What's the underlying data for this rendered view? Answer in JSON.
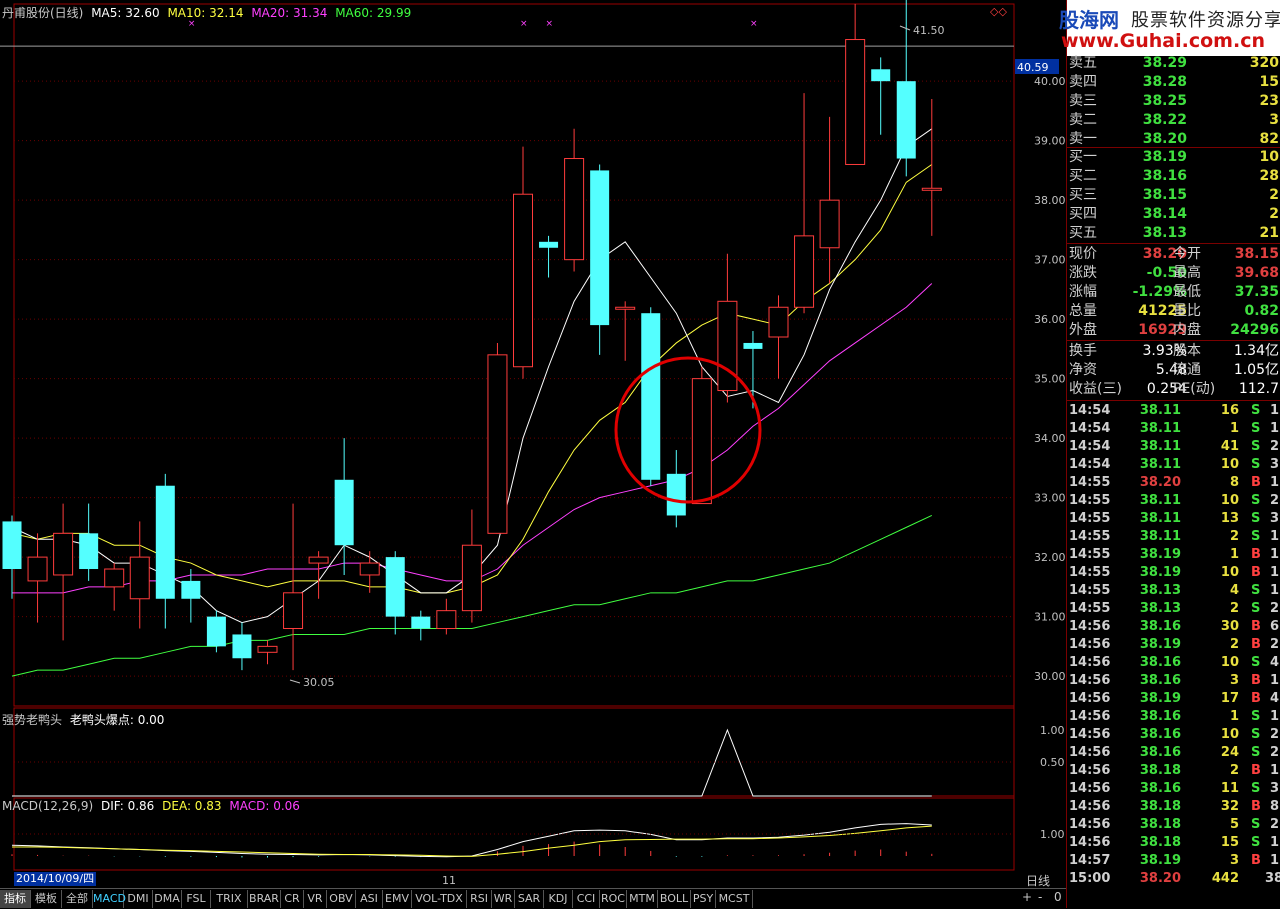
{
  "header": {
    "title": "丹甫股份(日线)",
    "ma5": "MA5: 32.60",
    "ma10": "MA10: 32.14",
    "ma20": "MA20: 31.34",
    "ma60": "MA60: 29.99"
  },
  "chart_data": {
    "type": "candlestick",
    "ylim": [
      29.8,
      41.6
    ],
    "y_ticks": [
      "40.00",
      "39.00",
      "38.00",
      "37.00",
      "36.00",
      "35.00",
      "34.00",
      "33.00",
      "32.00",
      "31.00",
      "30.00"
    ],
    "high_label": "41.50",
    "low_label": "30.05",
    "current_line_label": "40.59",
    "candles": [
      {
        "o": 32.6,
        "c": 31.8,
        "h": 32.7,
        "l": 31.3
      },
      {
        "o": 31.6,
        "c": 32.0,
        "h": 32.4,
        "l": 30.9
      },
      {
        "o": 31.7,
        "c": 32.4,
        "h": 32.9,
        "l": 30.6
      },
      {
        "o": 32.4,
        "c": 31.8,
        "h": 32.9,
        "l": 31.6
      },
      {
        "o": 31.5,
        "c": 31.8,
        "h": 31.9,
        "l": 31.1
      },
      {
        "o": 31.3,
        "c": 32.0,
        "h": 32.6,
        "l": 30.8
      },
      {
        "o": 33.2,
        "c": 31.3,
        "h": 33.4,
        "l": 30.8
      },
      {
        "o": 31.6,
        "c": 31.3,
        "h": 31.8,
        "l": 30.9
      },
      {
        "o": 31.0,
        "c": 30.5,
        "h": 31.1,
        "l": 30.4
      },
      {
        "o": 30.7,
        "c": 30.3,
        "h": 30.9,
        "l": 30.1
      },
      {
        "o": 30.4,
        "c": 30.5,
        "h": 30.6,
        "l": 30.2
      },
      {
        "o": 30.8,
        "c": 31.4,
        "h": 32.9,
        "l": 30.1
      },
      {
        "o": 31.9,
        "c": 32.0,
        "h": 32.1,
        "l": 31.3
      },
      {
        "o": 33.3,
        "c": 32.2,
        "h": 34.0,
        "l": 31.7
      },
      {
        "o": 31.7,
        "c": 31.9,
        "h": 32.1,
        "l": 31.4
      },
      {
        "o": 32.0,
        "c": 31.0,
        "h": 32.1,
        "l": 30.7
      },
      {
        "o": 31.0,
        "c": 30.8,
        "h": 31.1,
        "l": 30.6
      },
      {
        "o": 30.8,
        "c": 31.1,
        "h": 31.3,
        "l": 30.7
      },
      {
        "o": 31.1,
        "c": 32.2,
        "h": 32.8,
        "l": 30.9
      },
      {
        "o": 32.4,
        "c": 35.4,
        "h": 35.6,
        "l": 32.4
      },
      {
        "o": 35.2,
        "c": 38.1,
        "h": 38.9,
        "l": 35.0
      },
      {
        "o": 37.3,
        "c": 37.2,
        "h": 37.4,
        "l": 36.7
      },
      {
        "o": 37.0,
        "c": 38.7,
        "h": 39.2,
        "l": 36.8
      },
      {
        "o": 38.5,
        "c": 35.9,
        "h": 38.6,
        "l": 35.4
      },
      {
        "o": 36.2,
        "c": 36.2,
        "h": 36.3,
        "l": 35.3
      },
      {
        "o": 36.1,
        "c": 33.3,
        "h": 36.2,
        "l": 33.2
      },
      {
        "o": 33.4,
        "c": 32.7,
        "h": 33.8,
        "l": 32.5
      },
      {
        "o": 32.9,
        "c": 35.0,
        "h": 35.2,
        "l": 32.9
      },
      {
        "o": 34.8,
        "c": 36.3,
        "h": 37.1,
        "l": 34.6
      },
      {
        "o": 35.6,
        "c": 35.5,
        "h": 35.8,
        "l": 34.5
      },
      {
        "o": 35.7,
        "c": 36.2,
        "h": 36.4,
        "l": 35.0
      },
      {
        "o": 36.2,
        "c": 37.4,
        "h": 39.8,
        "l": 36.1
      },
      {
        "o": 37.2,
        "c": 38.0,
        "h": 39.4,
        "l": 36.6
      },
      {
        "o": 38.6,
        "c": 40.7,
        "h": 41.3,
        "l": 38.6
      },
      {
        "o": 40.2,
        "c": 40.0,
        "h": 40.4,
        "l": 39.1
      },
      {
        "o": 40.0,
        "c": 38.7,
        "h": 41.5,
        "l": 38.4
      },
      {
        "o": 38.2,
        "c": 38.2,
        "h": 39.7,
        "l": 37.4
      }
    ],
    "ma5": [
      32.5,
      32.3,
      32.3,
      32.2,
      31.9,
      31.9,
      31.7,
      31.5,
      31.1,
      30.9,
      31.0,
      31.3,
      31.6,
      32.2,
      32.0,
      31.7,
      31.4,
      31.4,
      31.7,
      32.2,
      34.0,
      35.2,
      36.3,
      37.0,
      37.3,
      36.7,
      36.1,
      35.2,
      34.7,
      34.8,
      34.6,
      35.4,
      36.5,
      37.3,
      38.0,
      38.9,
      39.2
    ],
    "ma10": [
      32.4,
      32.3,
      32.4,
      32.4,
      32.2,
      32.2,
      32.0,
      31.9,
      31.7,
      31.6,
      31.5,
      31.6,
      31.6,
      31.6,
      31.5,
      31.5,
      31.4,
      31.4,
      31.5,
      31.7,
      32.3,
      33.1,
      33.8,
      34.3,
      34.6,
      35.2,
      35.6,
      35.9,
      36.1,
      36.0,
      35.9,
      36.3,
      36.6,
      37.0,
      37.5,
      38.3,
      38.6
    ],
    "ma20": [
      31.4,
      31.4,
      31.4,
      31.5,
      31.5,
      31.6,
      31.6,
      31.7,
      31.7,
      31.7,
      31.8,
      31.8,
      31.8,
      31.9,
      31.9,
      31.8,
      31.7,
      31.6,
      31.6,
      31.8,
      32.2,
      32.5,
      32.8,
      33.0,
      33.1,
      33.2,
      33.3,
      33.5,
      33.8,
      34.2,
      34.5,
      34.9,
      35.3,
      35.6,
      35.9,
      36.2,
      36.6
    ],
    "ma60": [
      30.0,
      30.1,
      30.1,
      30.2,
      30.3,
      30.3,
      30.4,
      30.5,
      30.5,
      30.6,
      30.6,
      30.7,
      30.7,
      30.7,
      30.8,
      30.8,
      30.8,
      30.8,
      30.8,
      30.9,
      31.0,
      31.1,
      31.2,
      31.2,
      31.3,
      31.4,
      31.4,
      31.5,
      31.6,
      31.6,
      31.7,
      31.8,
      31.9,
      32.1,
      32.3,
      32.5,
      32.7
    ],
    "signals": [
      7,
      20,
      21,
      29
    ],
    "ind1": {
      "label": "强势老鸭头",
      "sub": "老鸭头爆点: 0.00",
      "ticks": [
        "1.00",
        "0.50"
      ],
      "values": [
        0,
        0,
        0,
        0,
        0,
        0,
        0,
        0,
        0,
        0,
        0,
        0,
        0,
        0,
        0,
        0,
        0,
        0,
        0,
        0,
        0,
        0,
        0,
        0,
        0,
        0,
        0,
        0,
        1,
        0,
        0,
        0,
        0,
        0,
        0,
        0,
        0
      ]
    },
    "macd": {
      "label": "MACD(12,26,9)",
      "dif": "DIF: 0.86",
      "dea": "DEA: 0.83",
      "macd": "MACD: 0.06",
      "ticks": [
        "1.00"
      ],
      "dif_v": [
        0.3,
        0.28,
        0.25,
        0.23,
        0.2,
        0.18,
        0.15,
        0.13,
        0.1,
        0.07,
        0.05,
        0.04,
        0.03,
        0.04,
        0.03,
        0.01,
        -0.01,
        -0.02,
        0.0,
        0.18,
        0.4,
        0.55,
        0.7,
        0.72,
        0.7,
        0.6,
        0.45,
        0.45,
        0.5,
        0.5,
        0.52,
        0.58,
        0.66,
        0.78,
        0.88,
        0.9,
        0.86
      ],
      "dea_v": [
        0.25,
        0.25,
        0.24,
        0.22,
        0.2,
        0.18,
        0.16,
        0.15,
        0.13,
        0.11,
        0.09,
        0.07,
        0.05,
        0.04,
        0.04,
        0.03,
        0.02,
        0.0,
        -0.01,
        0.05,
        0.12,
        0.22,
        0.3,
        0.4,
        0.45,
        0.46,
        0.47,
        0.47,
        0.48,
        0.48,
        0.5,
        0.53,
        0.57,
        0.63,
        0.7,
        0.78,
        0.83
      ],
      "hist": [
        0.05,
        0.03,
        0.01,
        0.01,
        -0.01,
        -0.01,
        -0.02,
        -0.02,
        -0.03,
        -0.04,
        -0.04,
        -0.03,
        -0.02,
        0,
        -0.01,
        -0.02,
        -0.03,
        -0.02,
        0.01,
        0.13,
        0.28,
        0.33,
        0.4,
        0.32,
        0.25,
        0.14,
        -0.02,
        -0.02,
        0.02,
        0.02,
        0.02,
        0.05,
        0.09,
        0.15,
        0.18,
        0.12,
        0.06
      ]
    }
  },
  "date_label": "2014/10/09/四",
  "axis_mark": "11",
  "period_label": "日线",
  "tabs": [
    "指标",
    "模板",
    "全部",
    "MACD",
    "DMI",
    "DMA",
    "FSL",
    "TRIX",
    "BRAR",
    "CR",
    "VR",
    "OBV",
    "ASI",
    "EMV",
    "VOL-TDX",
    "RSI",
    "WR",
    "SAR",
    "KDJ",
    "CCI",
    "ROC",
    "MTM",
    "BOLL",
    "PSY",
    "MCST"
  ],
  "nav": {
    "plus": "+",
    "minus": "-",
    "zero": "0"
  },
  "logo": {
    "l1": "股海网",
    "l1b": "股票软件资源分享",
    "l2": "www.Guhai.com.cn"
  },
  "order_book": {
    "sell": [
      {
        "label": "卖五",
        "price": "38.29",
        "vol": "320"
      },
      {
        "label": "卖四",
        "price": "38.28",
        "vol": "15"
      },
      {
        "label": "卖三",
        "price": "38.25",
        "vol": "23"
      },
      {
        "label": "卖二",
        "price": "38.22",
        "vol": "3"
      },
      {
        "label": "卖一",
        "price": "38.20",
        "vol": "82"
      }
    ],
    "buy": [
      {
        "label": "买一",
        "price": "38.19",
        "vol": "10"
      },
      {
        "label": "买二",
        "price": "38.16",
        "vol": "28"
      },
      {
        "label": "买三",
        "price": "38.15",
        "vol": "2"
      },
      {
        "label": "买四",
        "price": "38.14",
        "vol": "2"
      },
      {
        "label": "买五",
        "price": "38.13",
        "vol": "21"
      }
    ]
  },
  "quote": [
    {
      "l1": "现价",
      "v1": "38.20",
      "c1": "#e04040",
      "l2": "今开",
      "v2": "38.15",
      "c2": "#e04040"
    },
    {
      "l1": "涨跌",
      "v1": "-0.50",
      "c1": "#40e040",
      "l2": "最高",
      "v2": "39.68",
      "c2": "#e04040"
    },
    {
      "l1": "涨幅",
      "v1": "-1.29%",
      "c1": "#40e040",
      "l2": "最低",
      "v2": "37.35",
      "c2": "#40e040"
    },
    {
      "l1": "总量",
      "v1": "41225",
      "c1": "#e8e040",
      "l2": "量比",
      "v2": "0.82",
      "c2": "#40e040"
    },
    {
      "l1": "外盘",
      "v1": "16929",
      "c1": "#e04040",
      "l2": "内盘",
      "v2": "24296",
      "c2": "#40e040"
    }
  ],
  "fund": [
    {
      "l1": "换手",
      "v1": "3.93%",
      "l2": "股本",
      "v2": "1.34亿"
    },
    {
      "l1": "净资",
      "v1": "5.48",
      "l2": "流通",
      "v2": "1.05亿"
    },
    {
      "l1": "收益(三)",
      "v1": "0.254",
      "l2": "PE(动)",
      "v2": "112.7"
    }
  ],
  "trades": [
    {
      "t": "14:54",
      "p": "38.11",
      "v": "16",
      "s": "S",
      "n": "1"
    },
    {
      "t": "14:54",
      "p": "38.11",
      "v": "1",
      "s": "S",
      "n": "1"
    },
    {
      "t": "14:54",
      "p": "38.11",
      "v": "41",
      "s": "S",
      "n": "2"
    },
    {
      "t": "14:54",
      "p": "38.11",
      "v": "10",
      "s": "S",
      "n": "3"
    },
    {
      "t": "14:55",
      "p": "38.20",
      "v": "8",
      "s": "B",
      "n": "1"
    },
    {
      "t": "14:55",
      "p": "38.11",
      "v": "10",
      "s": "S",
      "n": "2"
    },
    {
      "t": "14:55",
      "p": "38.11",
      "v": "13",
      "s": "S",
      "n": "3"
    },
    {
      "t": "14:55",
      "p": "38.11",
      "v": "2",
      "s": "S",
      "n": "1"
    },
    {
      "t": "14:55",
      "p": "38.19",
      "v": "1",
      "s": "B",
      "n": "1"
    },
    {
      "t": "14:55",
      "p": "38.19",
      "v": "10",
      "s": "B",
      "n": "1"
    },
    {
      "t": "14:55",
      "p": "38.13",
      "v": "4",
      "s": "S",
      "n": "1"
    },
    {
      "t": "14:55",
      "p": "38.13",
      "v": "2",
      "s": "S",
      "n": "2"
    },
    {
      "t": "14:56",
      "p": "38.16",
      "v": "30",
      "s": "B",
      "n": "6"
    },
    {
      "t": "14:56",
      "p": "38.19",
      "v": "2",
      "s": "B",
      "n": "2"
    },
    {
      "t": "14:56",
      "p": "38.16",
      "v": "10",
      "s": "S",
      "n": "4"
    },
    {
      "t": "14:56",
      "p": "38.16",
      "v": "3",
      "s": "B",
      "n": "1"
    },
    {
      "t": "14:56",
      "p": "38.19",
      "v": "17",
      "s": "B",
      "n": "4"
    },
    {
      "t": "14:56",
      "p": "38.16",
      "v": "1",
      "s": "S",
      "n": "1"
    },
    {
      "t": "14:56",
      "p": "38.16",
      "v": "10",
      "s": "S",
      "n": "2"
    },
    {
      "t": "14:56",
      "p": "38.16",
      "v": "24",
      "s": "S",
      "n": "2"
    },
    {
      "t": "14:56",
      "p": "38.18",
      "v": "2",
      "s": "B",
      "n": "1"
    },
    {
      "t": "14:56",
      "p": "38.16",
      "v": "11",
      "s": "S",
      "n": "3"
    },
    {
      "t": "14:56",
      "p": "38.18",
      "v": "32",
      "s": "B",
      "n": "8"
    },
    {
      "t": "14:56",
      "p": "38.18",
      "v": "5",
      "s": "S",
      "n": "2"
    },
    {
      "t": "14:56",
      "p": "38.18",
      "v": "15",
      "s": "S",
      "n": "1"
    },
    {
      "t": "14:57",
      "p": "38.19",
      "v": "3",
      "s": "B",
      "n": "1"
    },
    {
      "t": "15:00",
      "p": "38.20",
      "v": "442",
      "s": "",
      "n": "38"
    }
  ],
  "colors": {
    "up": "#ff3c3c",
    "down": "#54ffff",
    "ma5": "#ffffff",
    "ma10": "#ffff40",
    "ma20": "#ff40ff",
    "ma60": "#40ff40",
    "signal": "#ff40ff",
    "circle": "#e00000"
  }
}
